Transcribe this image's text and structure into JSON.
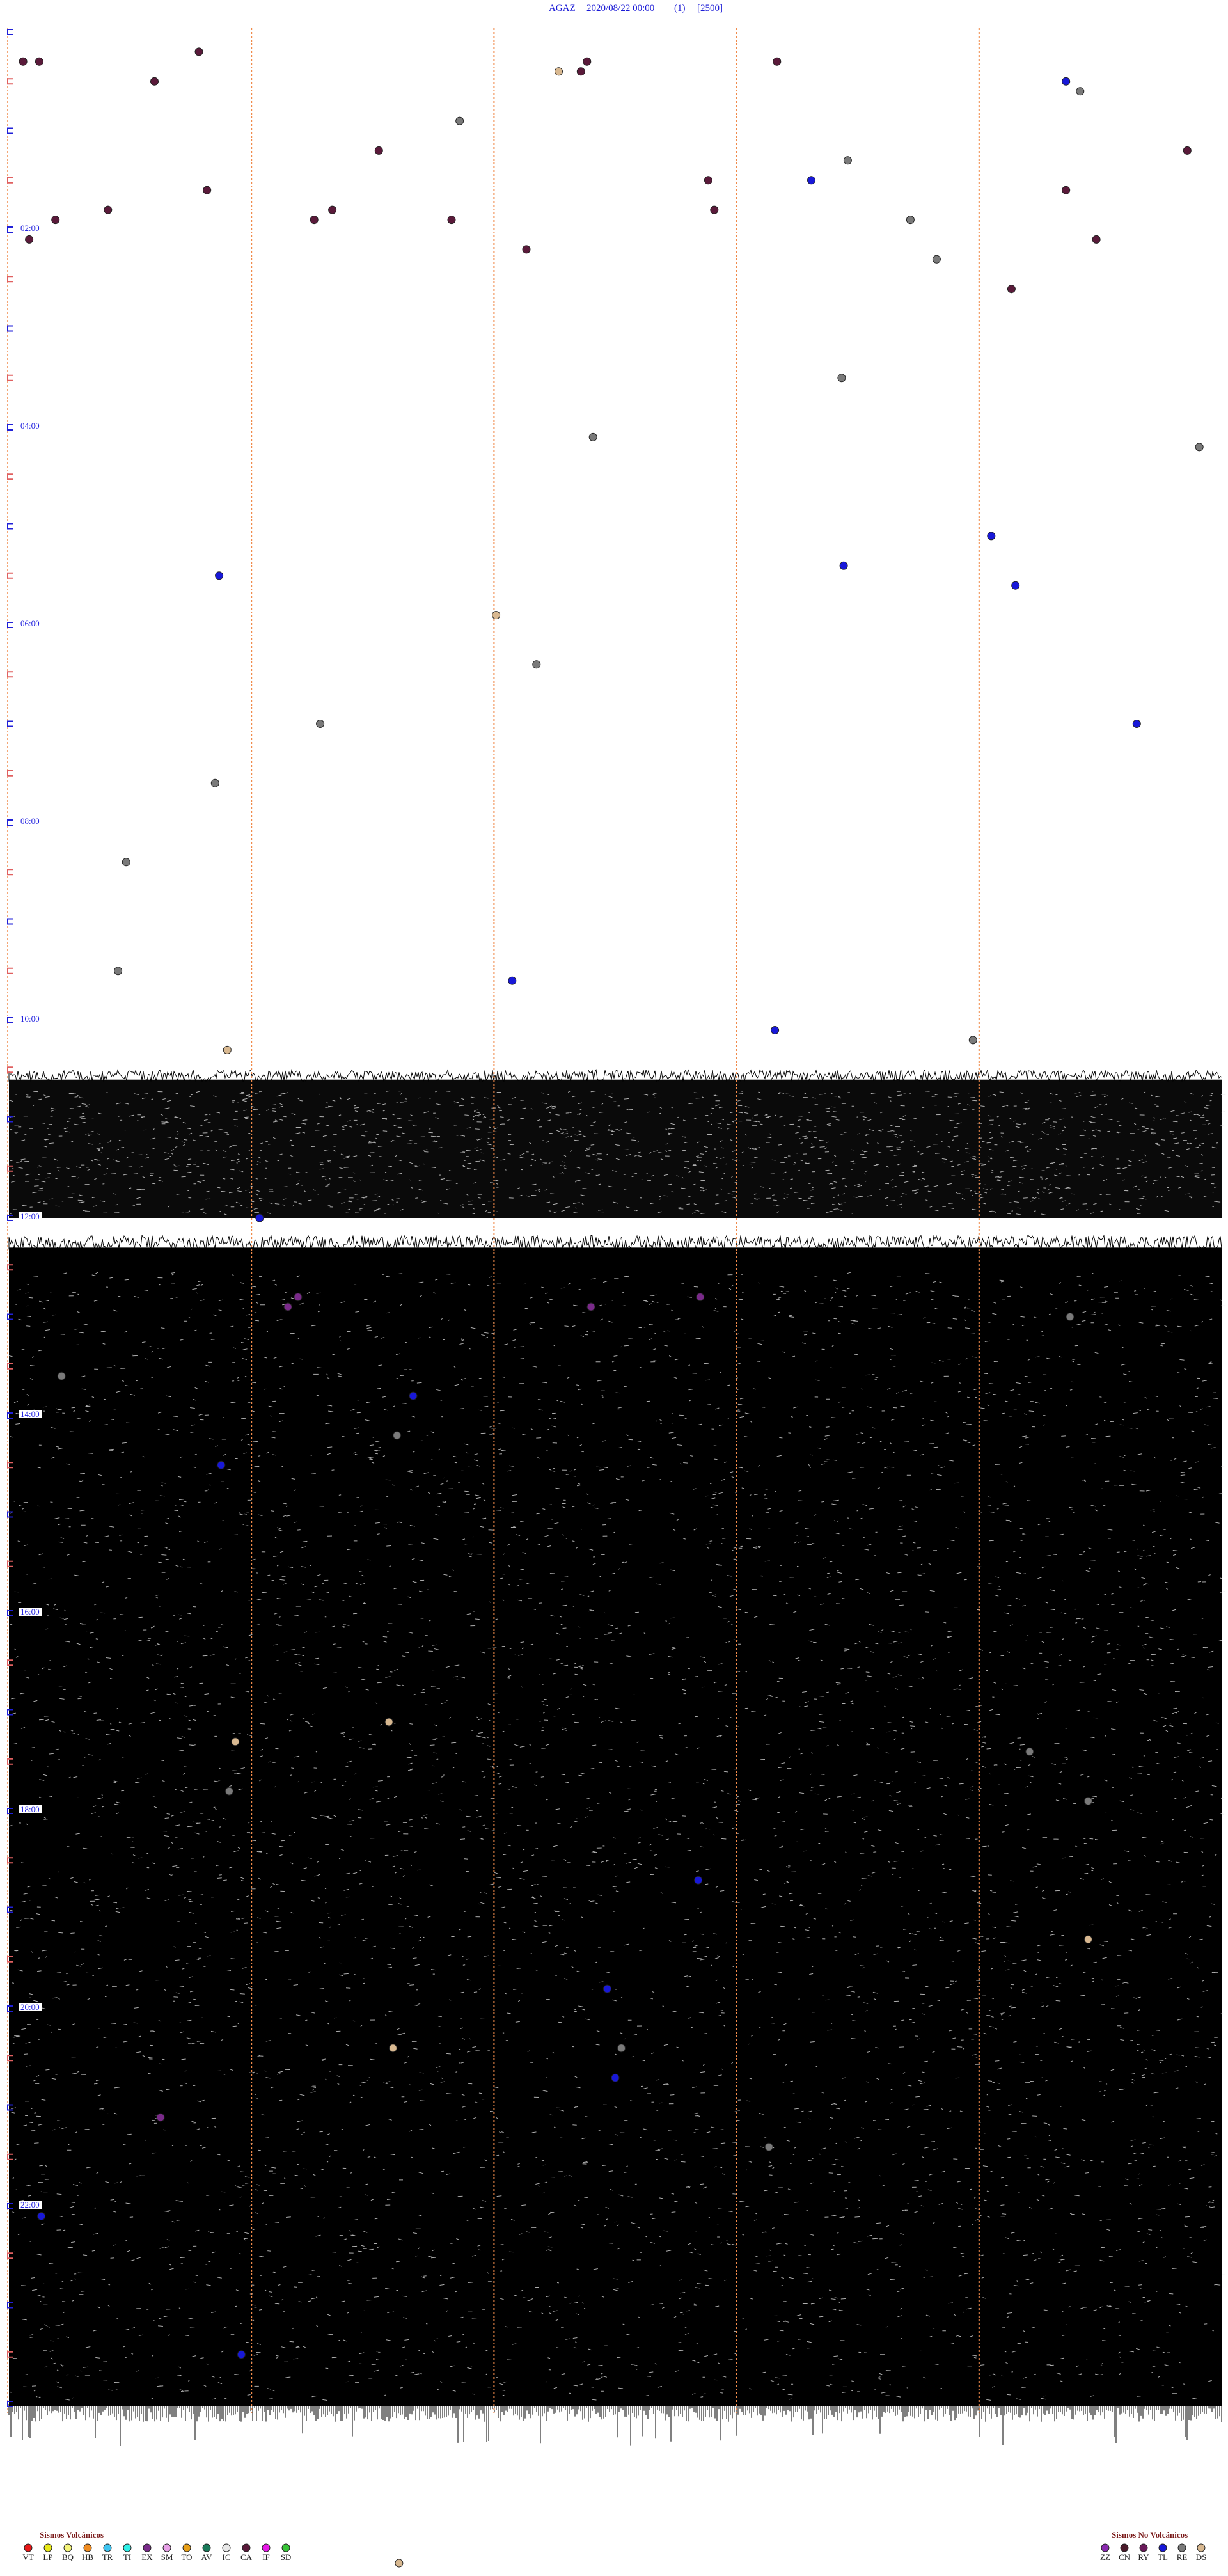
{
  "header": {
    "station": "AGAZ",
    "datetime": "2020/08/22 00:00",
    "component": "(1)",
    "scale": "[2500]"
  },
  "chart_data": {
    "type": "scatter",
    "subtype": "helicorder",
    "x_unit": "minutes past the hour",
    "xlim": [
      0,
      60
    ],
    "y_unit": "hour of day (UTC)",
    "ylim": [
      0,
      24
    ],
    "hour_labels": [
      "02:00",
      "04:00",
      "06:00",
      "08:00",
      "10:00",
      "12:00",
      "14:00",
      "16:00",
      "18:00",
      "20:00",
      "22:00"
    ],
    "hour_label_values": [
      2,
      4,
      6,
      8,
      10,
      12,
      14,
      16,
      18,
      20,
      22
    ],
    "noise_onset_hour": 10.6,
    "noise_heavy_hour": 12.3,
    "quiet_band_hours": [
      12.0,
      12.3
    ],
    "minute_markers": [
      12,
      24,
      36,
      48
    ],
    "events": [
      {
        "t": 0.3,
        "m": 0.7,
        "c": "CA"
      },
      {
        "t": 0.3,
        "m": 38.0,
        "c": "CA"
      },
      {
        "t": 0.2,
        "m": 9.4,
        "c": "CA"
      },
      {
        "t": 0.3,
        "m": 1.5,
        "c": "CA"
      },
      {
        "t": 0.5,
        "m": 7.2,
        "c": "CA"
      },
      {
        "t": 0.4,
        "m": 27.2,
        "c": "DS"
      },
      {
        "t": 0.5,
        "m": 52.3,
        "c": "TL"
      },
      {
        "t": 0.6,
        "m": 53.0,
        "c": "RE"
      },
      {
        "t": 0.4,
        "m": 28.3,
        "c": "CA"
      },
      {
        "t": 0.3,
        "m": 28.6,
        "c": "CA"
      },
      {
        "t": 0.9,
        "m": 22.3,
        "c": "RE"
      },
      {
        "t": 1.2,
        "m": 18.3,
        "c": "CA"
      },
      {
        "t": 1.2,
        "m": 58.3,
        "c": "CA"
      },
      {
        "t": 1.3,
        "m": 41.5,
        "c": "RE"
      },
      {
        "t": 1.5,
        "m": 39.7,
        "c": "TL"
      },
      {
        "t": 1.5,
        "m": 34.6,
        "c": "CA"
      },
      {
        "t": 1.6,
        "m": 9.8,
        "c": "CA"
      },
      {
        "t": 1.6,
        "m": 52.3,
        "c": "CA"
      },
      {
        "t": 1.8,
        "m": 4.9,
        "c": "CA"
      },
      {
        "t": 1.8,
        "m": 34.9,
        "c": "CA"
      },
      {
        "t": 1.8,
        "m": 16.0,
        "c": "CA"
      },
      {
        "t": 1.9,
        "m": 2.3,
        "c": "CA"
      },
      {
        "t": 1.9,
        "m": 44.6,
        "c": "RE"
      },
      {
        "t": 1.9,
        "m": 15.1,
        "c": "CA"
      },
      {
        "t": 1.9,
        "m": 21.9,
        "c": "CA"
      },
      {
        "t": 2.1,
        "m": 1.0,
        "c": "CA"
      },
      {
        "t": 2.1,
        "m": 53.8,
        "c": "CA"
      },
      {
        "t": 2.2,
        "m": 25.6,
        "c": "CA"
      },
      {
        "t": 2.3,
        "m": 45.9,
        "c": "RE"
      },
      {
        "t": 2.6,
        "m": 49.6,
        "c": "CA"
      },
      {
        "t": 3.5,
        "m": 41.2,
        "c": "RE"
      },
      {
        "t": 4.1,
        "m": 28.9,
        "c": "RE"
      },
      {
        "t": 4.2,
        "m": 58.9,
        "c": "RE"
      },
      {
        "t": 5.1,
        "m": 48.6,
        "c": "TL"
      },
      {
        "t": 5.4,
        "m": 41.3,
        "c": "TL"
      },
      {
        "t": 5.5,
        "m": 10.4,
        "c": "TL"
      },
      {
        "t": 5.6,
        "m": 49.8,
        "c": "TL"
      },
      {
        "t": 5.9,
        "m": 24.1,
        "c": "DS"
      },
      {
        "t": 6.4,
        "m": 26.1,
        "c": "RE"
      },
      {
        "t": 7.0,
        "m": 15.4,
        "c": "RE"
      },
      {
        "t": 7.0,
        "m": 55.8,
        "c": "TL"
      },
      {
        "t": 7.6,
        "m": 10.2,
        "c": "RE"
      },
      {
        "t": 8.4,
        "m": 5.8,
        "c": "RE"
      },
      {
        "t": 9.5,
        "m": 5.4,
        "c": "RE"
      },
      {
        "t": 9.6,
        "m": 24.9,
        "c": "TL"
      },
      {
        "t": 10.1,
        "m": 37.9,
        "c": "TL"
      },
      {
        "t": 10.2,
        "m": 47.7,
        "c": "RE"
      },
      {
        "t": 10.3,
        "m": 10.8,
        "c": "DS"
      },
      {
        "t": 12.0,
        "m": 12.4,
        "c": "TL"
      },
      {
        "t": 12.8,
        "m": 14.3,
        "c": "EX"
      },
      {
        "t": 12.8,
        "m": 34.2,
        "c": "EX"
      },
      {
        "t": 12.9,
        "m": 13.8,
        "c": "EX"
      },
      {
        "t": 12.9,
        "m": 28.8,
        "c": "EX"
      },
      {
        "t": 13.0,
        "m": 52.5,
        "c": "RE"
      },
      {
        "t": 13.6,
        "m": 2.6,
        "c": "RE"
      },
      {
        "t": 13.8,
        "m": 20.0,
        "c": "TL"
      },
      {
        "t": 14.2,
        "m": 19.2,
        "c": "RE"
      },
      {
        "t": 14.5,
        "m": 10.5,
        "c": "TL"
      },
      {
        "t": 17.1,
        "m": 18.8,
        "c": "DS"
      },
      {
        "t": 17.3,
        "m": 11.2,
        "c": "DS"
      },
      {
        "t": 17.4,
        "m": 50.5,
        "c": "RE"
      },
      {
        "t": 17.8,
        "m": 10.9,
        "c": "RE"
      },
      {
        "t": 17.9,
        "m": 53.4,
        "c": "RE"
      },
      {
        "t": 18.7,
        "m": 34.1,
        "c": "TL"
      },
      {
        "t": 19.3,
        "m": 53.4,
        "c": "DS"
      },
      {
        "t": 19.8,
        "m": 29.6,
        "c": "TL"
      },
      {
        "t": 20.4,
        "m": 19.0,
        "c": "DS"
      },
      {
        "t": 20.4,
        "m": 30.3,
        "c": "RE"
      },
      {
        "t": 20.7,
        "m": 30.0,
        "c": "TL"
      },
      {
        "t": 21.1,
        "m": 7.5,
        "c": "EX"
      },
      {
        "t": 21.4,
        "m": 37.6,
        "c": "RE"
      },
      {
        "t": 22.1,
        "m": 1.6,
        "c": "TL"
      },
      {
        "t": 23.5,
        "m": 11.5,
        "c": "TL"
      }
    ],
    "extra_symbol": {
      "c": "DS",
      "m": 19.3
    }
  },
  "legend": {
    "volcanic_title": "Sismos Volcánicos",
    "volcanic": [
      {
        "code": "VT",
        "color": "#e81818"
      },
      {
        "code": "LP",
        "color": "#e8e818"
      },
      {
        "code": "BQ",
        "color": "#f5f57a"
      },
      {
        "code": "HB",
        "color": "#f08c20"
      },
      {
        "code": "TR",
        "color": "#3ec4f0"
      },
      {
        "code": "TI",
        "color": "#2ef0e8"
      },
      {
        "code": "EX",
        "color": "#7a2a8a"
      },
      {
        "code": "SM",
        "color": "#e8a0e8"
      },
      {
        "code": "TO",
        "color": "#e8a018"
      },
      {
        "code": "AV",
        "color": "#1a7a5a"
      },
      {
        "code": "IC",
        "color": "#e8e8e8"
      },
      {
        "code": "CA",
        "color": "#5a1a3a"
      },
      {
        "code": "IF",
        "color": "#e818e8"
      },
      {
        "code": "SD",
        "color": "#38c438"
      }
    ],
    "nonvolcanic_title": "Sismos No Volcánicos",
    "nonvolcanic": [
      {
        "code": "ZZ",
        "color": "#8a2ab0"
      },
      {
        "code": "CN",
        "color": "#4a1a2a"
      },
      {
        "code": "RY",
        "color": "#6a1a5a"
      },
      {
        "code": "TL",
        "color": "#1818d8"
      },
      {
        "code": "RE",
        "color": "#7a7a7a"
      },
      {
        "code": "DS",
        "color": "#d8b890"
      }
    ]
  }
}
